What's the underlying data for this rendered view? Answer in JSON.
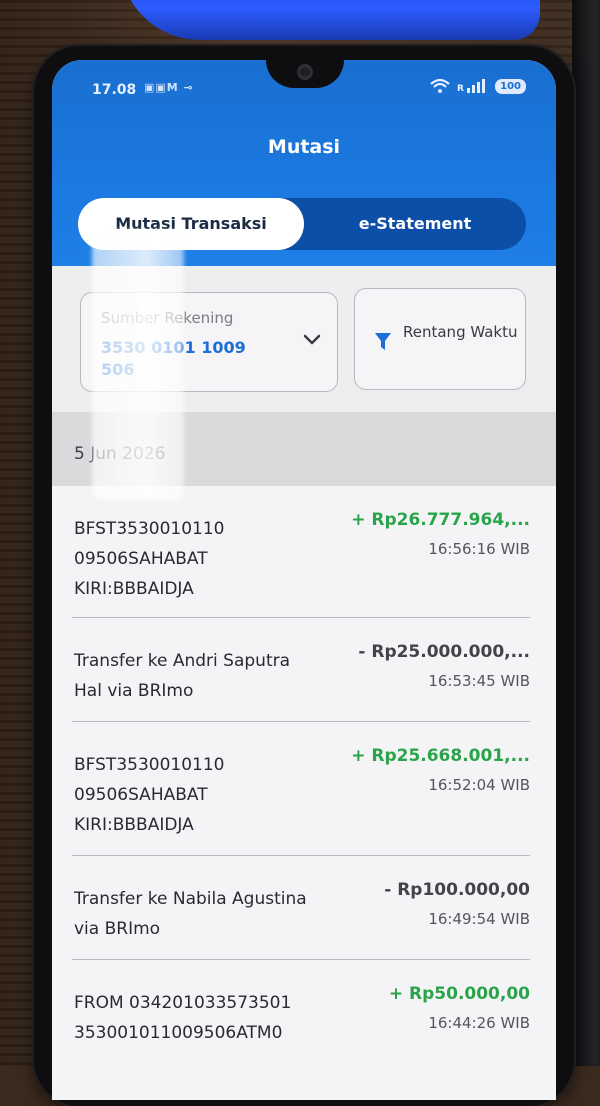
{
  "status_bar": {
    "time": "17.08",
    "notification_icons": "▣▣M ⊸",
    "battery": "100"
  },
  "header": {
    "title": "Mutasi"
  },
  "tabs": [
    {
      "label": "Mutasi Transaksi",
      "active": true
    },
    {
      "label": "e-Statement",
      "active": false
    }
  ],
  "source_account": {
    "label": "Sumber Rekening",
    "value": "3530 0101 1009 506"
  },
  "range": {
    "label": "Rentang Waktu"
  },
  "date_header": "5 Jun 2026",
  "transactions": [
    {
      "description": "BFST3530010110\n09506SAHABAT\nKIRI:BBBAIDJA",
      "amount": "+ Rp26.777.964,...",
      "time": "16:56:16 WIB",
      "type": "credit"
    },
    {
      "description": "Transfer ke Andri Saputra\nHal via BRImo",
      "amount": "- Rp25.000.000,...",
      "time": "16:53:45 WIB",
      "type": "debit"
    },
    {
      "description": "BFST3530010110\n09506SAHABAT\nKIRI:BBBAIDJA",
      "amount": "+ Rp25.668.001,...",
      "time": "16:52:04 WIB",
      "type": "credit"
    },
    {
      "description": "Transfer ke Nabila Agustina\nvia BRImo",
      "amount": "- Rp100.000,00",
      "time": "16:49:54 WIB",
      "type": "debit"
    },
    {
      "description": "FROM 034201033573501\n353001011009506ATM0",
      "amount": "+ Rp50.000,00",
      "time": "16:44:26 WIB",
      "type": "credit"
    }
  ],
  "colors": {
    "header_blue": "#1b79e0",
    "credit_green": "#2aa44a",
    "account_blue": "#1b6fd6"
  }
}
